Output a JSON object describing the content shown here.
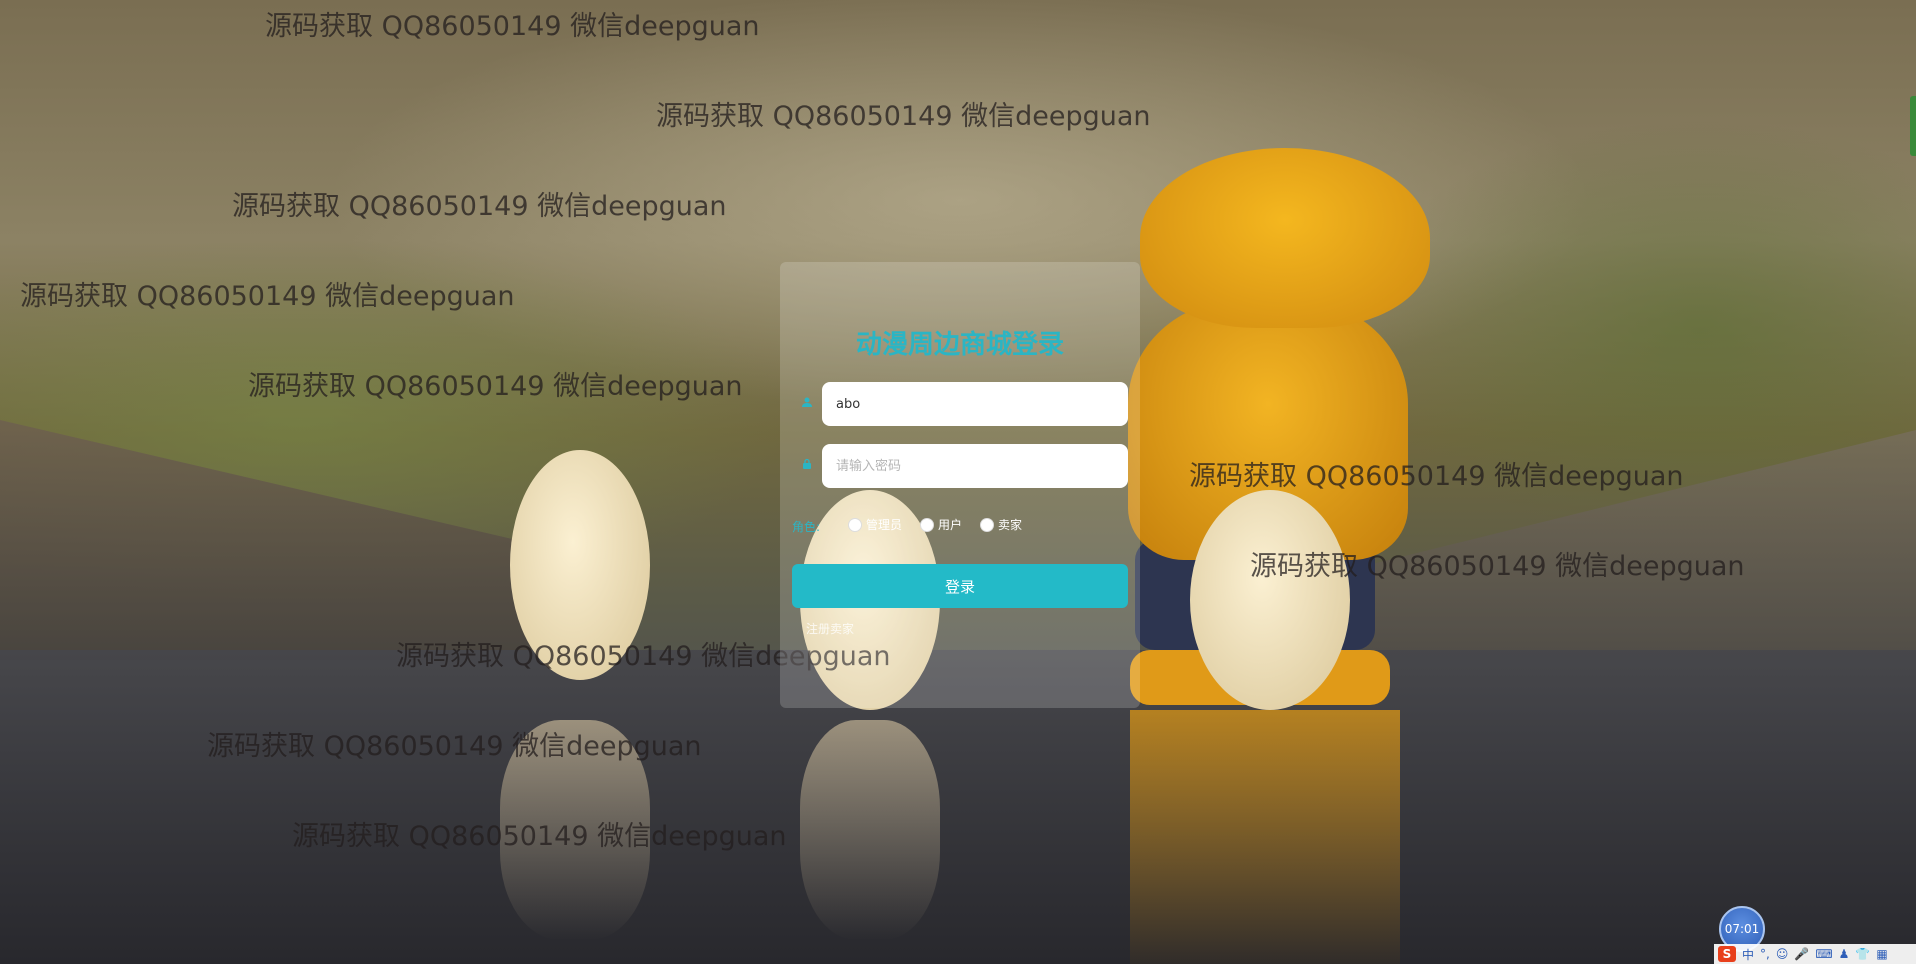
{
  "watermark": "源码获取 QQ86050149 微信deepguan",
  "login": {
    "title": "动漫周边商城登录",
    "username_icon": "user-icon",
    "username_value": "abo",
    "password_icon": "lock-icon",
    "password_placeholder": "请输入密码",
    "role_label": "角色:",
    "roles": [
      "管理员",
      "用户",
      "卖家"
    ],
    "login_button": "登录",
    "register_link": "注册卖家"
  },
  "system": {
    "clock_time": "07:01",
    "ime_logo": "S",
    "ime_mode": "中",
    "ime_punct": "°,",
    "ime_icons": [
      "emoji-icon",
      "microphone-icon",
      "keyboard-icon",
      "user-icon",
      "skin-icon",
      "grid-icon"
    ]
  },
  "colors": {
    "accent": "#23bac8",
    "title": "#2bb5c4"
  }
}
